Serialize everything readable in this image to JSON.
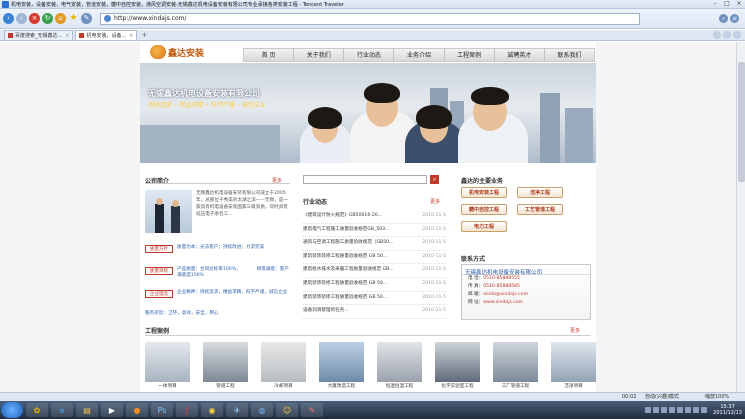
{
  "window": {
    "title": "机电安装，设备安装，电气安装，管道安装，糖中自控安装，通风空调安装-无锡鑫达机电设备安装有限公司专业承接各类安装工程 - Tencent Traveler"
  },
  "toolbar": {
    "url": "http://www.xindajs.com/"
  },
  "tabs": [
    {
      "label": "百度搜索_无锡鑫达..."
    },
    {
      "label": "机电安装，设备..."
    }
  ],
  "site": {
    "logo_text": "鑫达安装",
    "nav": [
      "首 页",
      "关于我们",
      "行业动态",
      "业务介绍",
      "工程案例",
      "诚聘英才",
      "联系我们"
    ],
    "banner": {
      "company": "无锡鑫达机电设备安装有限公司",
      "tagline": "持续追求 • 精益求精 • 科学严谨 • 诚信立业"
    },
    "intro": {
      "title": "公司简介",
      "more": "更多",
      "text": "无锡鑫达机电设备安装有限公司成立于2005年，总部位于秀美的太湖之滨——无锡，是一家具有机电设备安装国家三级资质，同时具有低压电子承包工..."
    },
    "values": [
      {
        "badge": "质量方针",
        "text": "质量为本；光法客户；持续改进；力求完美"
      },
      {
        "badge": "质量目标",
        "text": "产品质量：合同达标率100%，　　　　顾客满意：客户满意度100%"
      },
      {
        "badge": "企业理念",
        "text": "企业精神：持续追求，精益求精，科学严谨，诚信立业"
      }
    ],
    "service": "服务宗旨：卫环，高效，安全，用心",
    "news": {
      "title": "行业动态",
      "more": "更多",
      "items": [
        {
          "text": "《建筑设计防火规范》GB50016-20...",
          "date": "2010-11-5"
        },
        {
          "text": "建筑电气工程施工质量验收规范GB_503...",
          "date": "2010-11-5"
        },
        {
          "text": "通风与空调工程施工质量验收规范（GB50...",
          "date": "2010-11-5"
        },
        {
          "text": "建筑装饰装修工程质量验收规范 GB 50...",
          "date": "2010-11-5"
        },
        {
          "text": "建筑给水排水及采暖工程质量验收规范 GB...",
          "date": "2010-11-5"
        },
        {
          "text": "建筑装饰装修工程质量验收规范 GB 50...",
          "date": "2010-11-5"
        },
        {
          "text": "建筑装饰装修工程质量验收规范 GB 50...",
          "date": "2010-11-5"
        },
        {
          "text": "设备润滑管理的任务...",
          "date": "2010-11-5"
        }
      ]
    },
    "business": {
      "title": "鑫达的主要业务",
      "items": [
        "机电安装工程",
        "洁净工程",
        "糖中自控工程",
        "工艺管道工程",
        "电力工程"
      ]
    },
    "contact": {
      "title": "联系方式",
      "company": "无锡鑫达机电设备安装有限公司",
      "lines": [
        {
          "label": "电 话：",
          "value": "0510-85888555"
        },
        {
          "label": "传 真：",
          "value": "0510-85888585"
        },
        {
          "label": "邮 箱：",
          "value": "xinda@xindajs.com"
        },
        {
          "label": "网 址：",
          "value": "www.xindajs.com"
        }
      ]
    },
    "cases": {
      "title": "工程案例",
      "more": "更多",
      "items": [
        "一体项目",
        "管道工程",
        "冷却项目",
        "大厦改造工程",
        "恒温恒湿工程",
        "化学实验室工程",
        "工厂管道工程",
        "洁净项目"
      ]
    }
  },
  "status": {
    "time_left": "00:02",
    "mode": "自动(兴趣)模式",
    "zoom": "缩放100%"
  },
  "clock": {
    "time": "15:37",
    "date": "2011/12/13"
  }
}
